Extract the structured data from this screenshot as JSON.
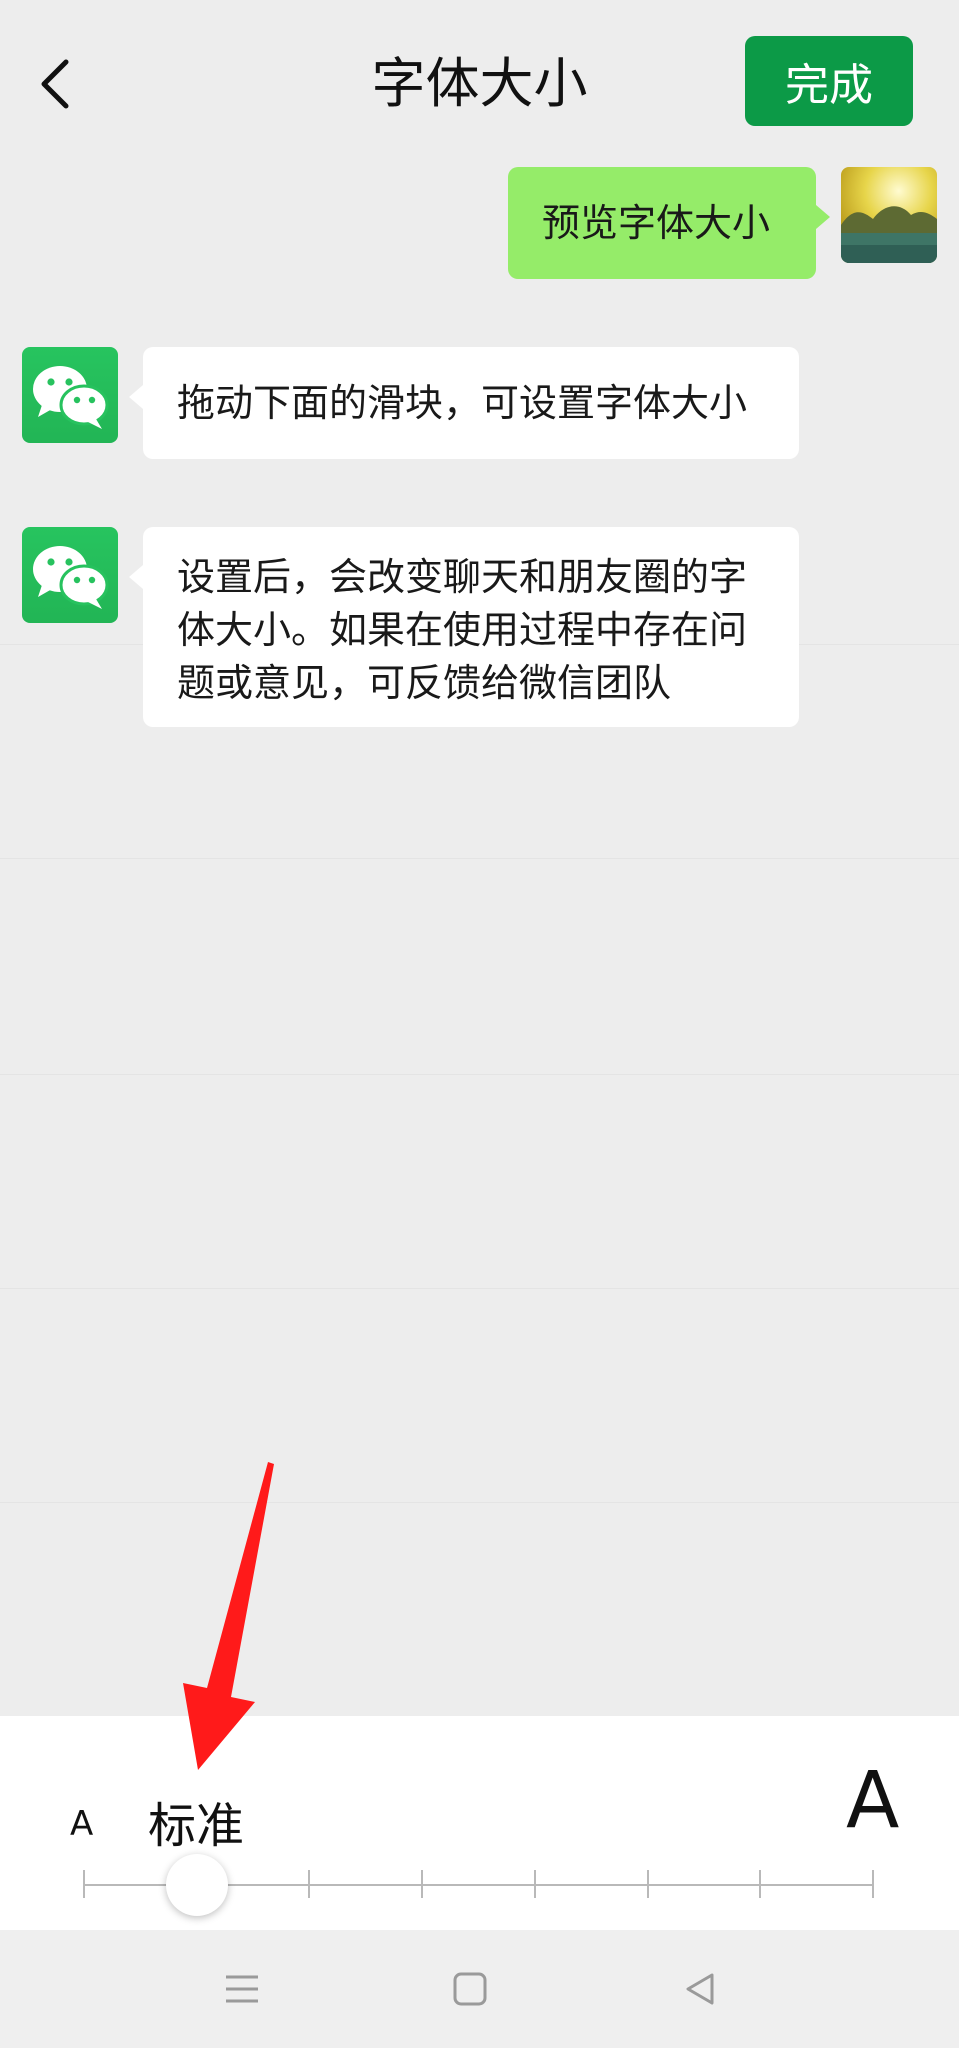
{
  "header": {
    "title": "字体大小",
    "done_label": "完成"
  },
  "messages": [
    {
      "side": "right",
      "text": "预览字体大小",
      "avatar": "user-photo-avatar"
    },
    {
      "side": "left",
      "text": "拖动下面的滑块，可设置字体大小",
      "avatar": "wechat-logo-avatar"
    },
    {
      "side": "left",
      "text": "设置后，会改变聊天和朋友圈的字体大小。如果在使用过程中存在问题或意见，可反馈给微信团队",
      "avatar": "wechat-logo-avatar"
    }
  ],
  "font_size": {
    "small_label": "A",
    "large_label": "A",
    "current_label": "标准",
    "levels": 8,
    "current_level": 2
  },
  "colors": {
    "accent": "#0c9a47",
    "sent_bubble": "#95ec69",
    "annotation_arrow": "#ff1a1a"
  },
  "nav": {
    "icons": [
      "menu-icon",
      "home-square-icon",
      "back-triangle-icon"
    ]
  }
}
